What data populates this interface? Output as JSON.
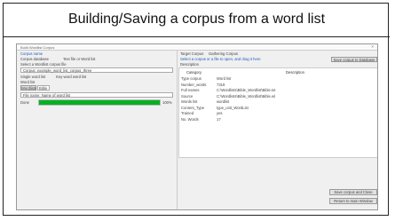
{
  "slide_title": "Building/Saving a corpus from a word list",
  "window": {
    "title": "Build Wordlist Corpus",
    "close_glyph": "×"
  },
  "left": {
    "corpus_label": "Corpus name",
    "radio_database": "Corpus database",
    "radio_database_alt": "Text file or Word list",
    "database_hint": "Select a Wordlist corpus file",
    "path_value": "Corpus: example_word_list_corpus_three",
    "radio_single": "Single word list",
    "radio_single_alt": "Key-word word list",
    "wordlist_label": "Word list",
    "source_tag": "Wordlists",
    "source_value": "Bible",
    "filter_value": "File name: Name of word list",
    "progress_label": "Done",
    "progress_value_text": "100%",
    "progress_fraction": 1.0
  },
  "right": {
    "header_label": "Target Corpus",
    "header_value": "Gathering Corpus",
    "info_line": "Select a corpus or a file to open, and drag it here",
    "desc_label": "Description",
    "save_btn": "Save corpus to Database",
    "columns": [
      "Category",
      "Description"
    ],
    "rows": [
      {
        "key": "Type corpus",
        "val": "Word list"
      },
      {
        "key": "Number_words",
        "val": "7318"
      },
      {
        "key": "Full names",
        "val": "C:\\Wordlists\\Bible_Wordlist\\Bible.txt"
      },
      {
        "key": "Source",
        "val": "C:\\Wordlists\\Bible_Wordlist\\Bible.wl"
      },
      {
        "key": "Words list",
        "val": "wordlist"
      },
      {
        "key": "Content_Type",
        "val": "type_unit_WordList"
      },
      {
        "key": "Trained",
        "val": "yes"
      },
      {
        "key": "No. Words",
        "val": "17"
      }
    ],
    "done_btn": "Save corpus and Close",
    "return_btn": "Return to main Window"
  }
}
